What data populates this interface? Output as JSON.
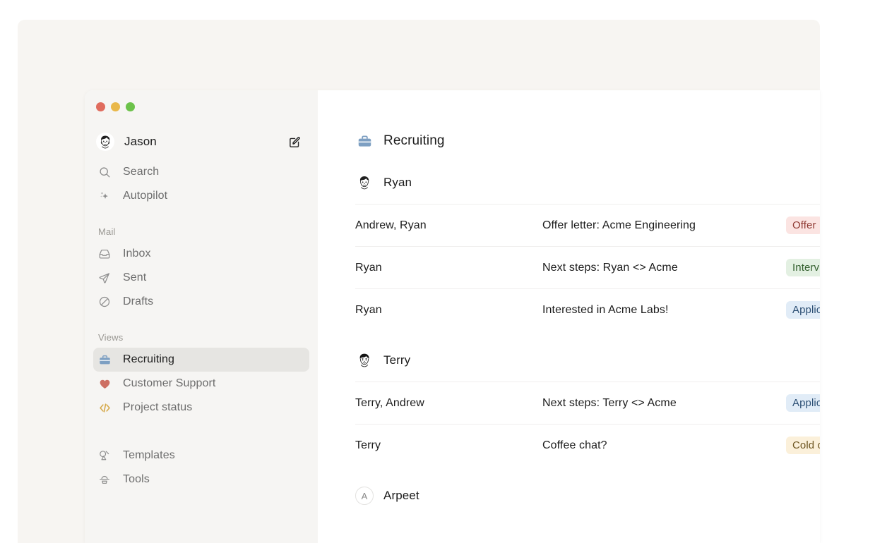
{
  "window": {
    "traffic_lights": [
      "close",
      "minimize",
      "maximize"
    ],
    "colors": {
      "page_background": "#ffffff",
      "backdrop": "#f7f5f2",
      "sidebar": "#f6f5f3",
      "content": "#ffffff",
      "active_item": "#e6e5e2",
      "accent_blue": "#7d9fc2",
      "accent_red": "#cd6f63",
      "accent_gold": "#d6aa4b",
      "divider": "#f0efee"
    }
  },
  "sidebar": {
    "account": {
      "name": "Jason",
      "avatar_icon": "user-avatar-photo",
      "compose_icon": "compose-pencil-icon"
    },
    "quick_items": [
      {
        "label": "Search",
        "icon": "search-icon"
      },
      {
        "label": "Autopilot",
        "icon": "sparkles-icon"
      }
    ],
    "mail_group": {
      "title": "Mail",
      "items": [
        {
          "label": "Inbox",
          "icon": "inbox-tray-icon"
        },
        {
          "label": "Sent",
          "icon": "paper-plane-icon"
        },
        {
          "label": "Drafts",
          "icon": "circle-slash-icon"
        }
      ]
    },
    "views_group": {
      "title": "Views",
      "items": [
        {
          "label": "Recruiting",
          "icon": "briefcase-icon",
          "color": "#7d9fc2",
          "active": true
        },
        {
          "label": "Customer Support",
          "icon": "heart-icon",
          "color": "#cd6f63",
          "active": false
        },
        {
          "label": "Project status",
          "icon": "code-brackets-icon",
          "color": "#d6aa4b",
          "active": false
        }
      ]
    },
    "footer_items": [
      {
        "label": "Templates",
        "icon": "templates-icon"
      },
      {
        "label": "Tools",
        "icon": "tools-icon"
      }
    ]
  },
  "main": {
    "view_title": "Recruiting",
    "view_icon": "briefcase-icon",
    "groups": [
      {
        "person": "Ryan",
        "avatar_icon": "user-avatar-photo-ryan",
        "avatar_type": "photo",
        "rows": [
          {
            "sender": "Andrew, Ryan",
            "subject": "Offer letter: Acme Engineering",
            "badge": "Offer",
            "badge_bg": "#fbe4e2",
            "badge_fg": "#8f3a33"
          },
          {
            "sender": "Ryan",
            "subject": "Next steps: Ryan <> Acme",
            "badge": "Interviewing",
            "badge_bg": "#e3f0e2",
            "badge_fg": "#34602f"
          },
          {
            "sender": "Ryan",
            "subject": "Interested in Acme Labs!",
            "badge": "Application",
            "badge_bg": "#e1ecf7",
            "badge_fg": "#2c4f74"
          }
        ]
      },
      {
        "person": "Terry",
        "avatar_icon": "user-avatar-photo-terry",
        "avatar_type": "photo",
        "rows": [
          {
            "sender": "Terry, Andrew",
            "subject": "Next steps: Terry <> Acme",
            "badge": "Application",
            "badge_bg": "#e1ecf7",
            "badge_fg": "#2c4f74"
          },
          {
            "sender": "Terry",
            "subject": "Coffee chat?",
            "badge": "Cold outreach",
            "badge_bg": "#fbf0da",
            "badge_fg": "#6d5520"
          }
        ]
      },
      {
        "person": "Arpeet",
        "avatar_icon": "letter-avatar",
        "avatar_type": "letter",
        "avatar_letter": "A",
        "rows": []
      }
    ]
  }
}
